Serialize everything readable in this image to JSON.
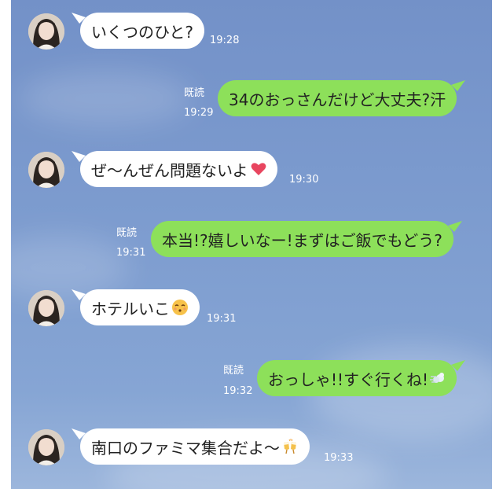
{
  "messages": [
    {
      "sender": "them",
      "text": "いくつのひと?",
      "time": "19:28"
    },
    {
      "sender": "me",
      "text": "34のおっさんだけど大丈夫?汗",
      "time": "19:29",
      "read": "既読"
    },
    {
      "sender": "them",
      "text": "ぜ〜んぜん問題ないよ",
      "emoji": "heart-icon",
      "time": "19:30"
    },
    {
      "sender": "me",
      "text": "本当!?嬉しいなー!まずはご飯でもどう?",
      "time": "19:31",
      "read": "既読"
    },
    {
      "sender": "them",
      "text": "ホテルいこ",
      "emoji": "kissing-face-icon",
      "time": "19:31"
    },
    {
      "sender": "me",
      "text": "おっしゃ!!すぐ行くね!",
      "emoji": "dash-icon",
      "time": "19:32",
      "read": "既読"
    },
    {
      "sender": "them",
      "text": "南口のファミマ集合だよ〜",
      "emoji": "clinking-glasses-icon",
      "time": "19:33"
    }
  ],
  "colors": {
    "chat_bg": "#7d9ccf",
    "outgoing_bubble": "#8de05a",
    "incoming_bubble": "#ffffff",
    "meta_text": "#ffffff"
  }
}
